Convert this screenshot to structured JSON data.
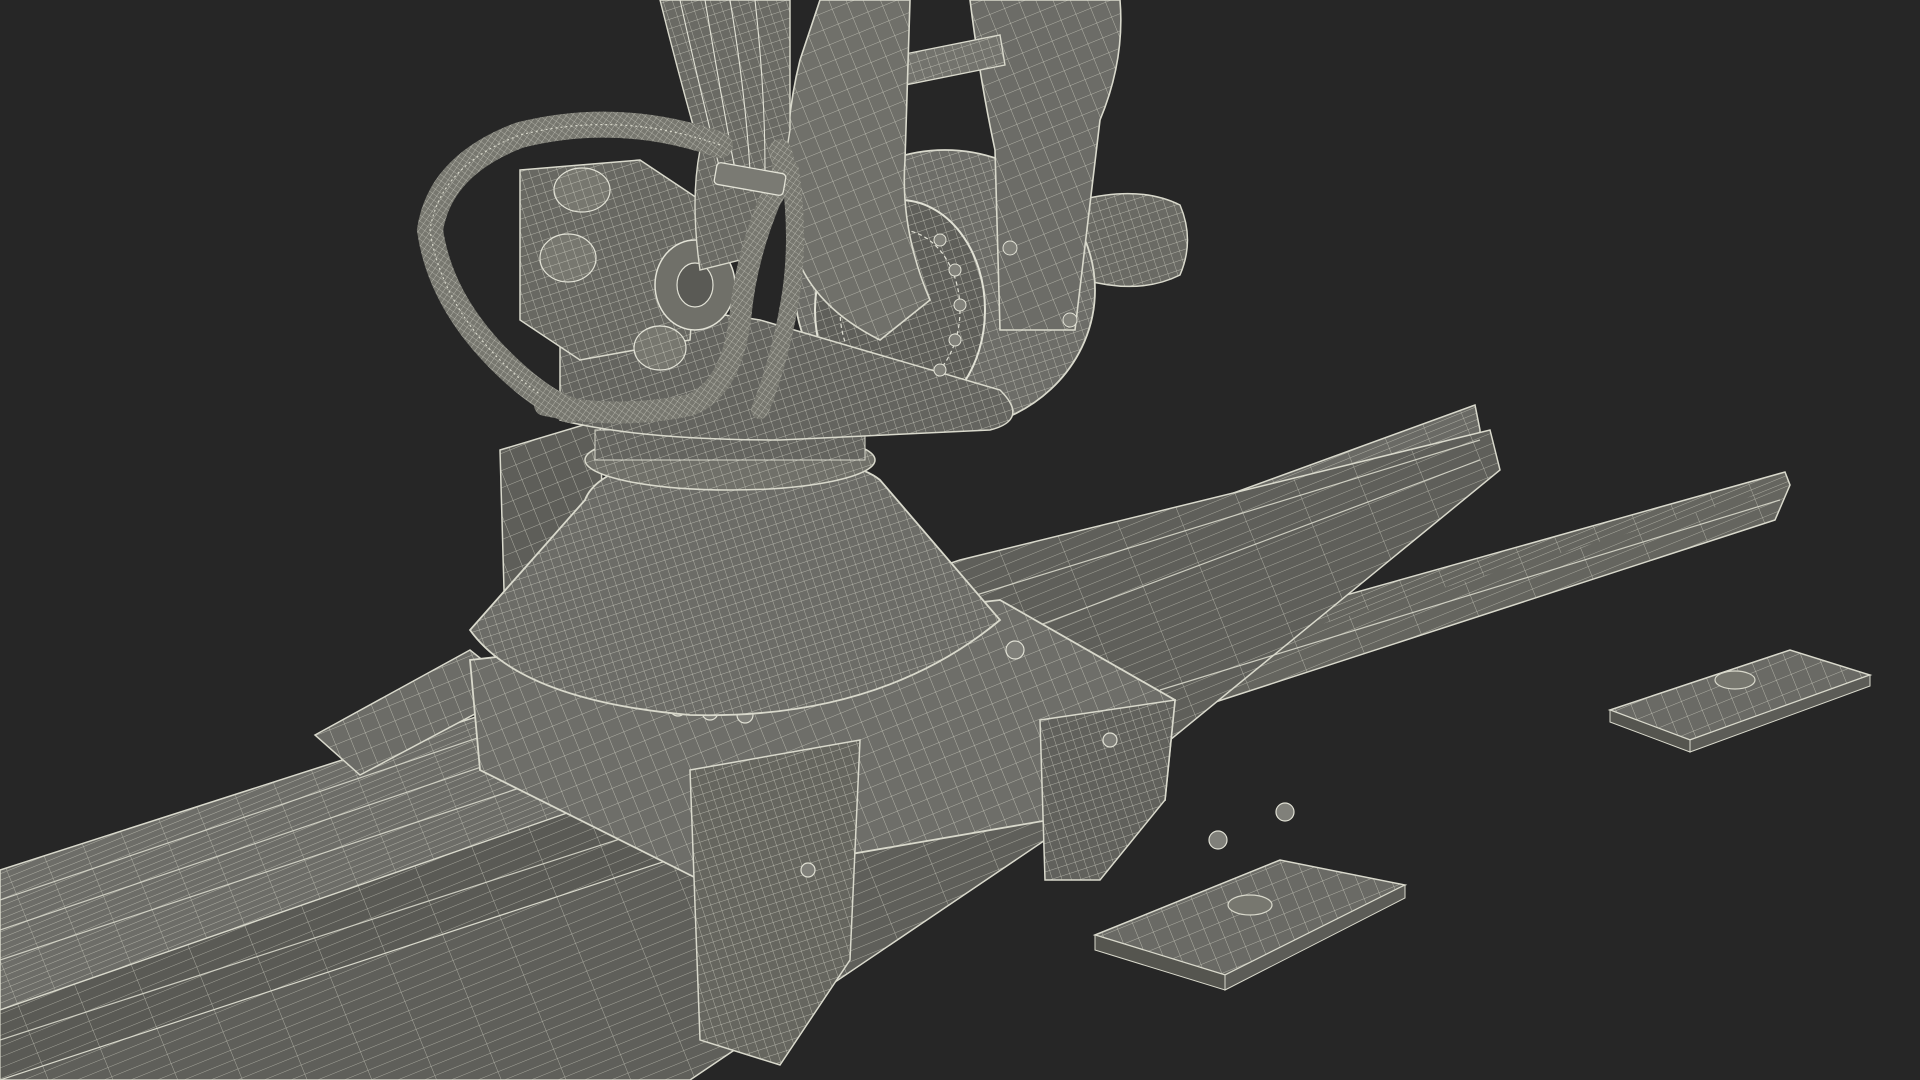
{
  "scene": {
    "background_color": "#262626",
    "model_fill": "#6f6f6a",
    "model_fill_dark": "#5a5a56",
    "model_fill_light": "#85857f",
    "wire_color": "#d9d9cc",
    "wire_color_dim": "#b8b8ac"
  }
}
